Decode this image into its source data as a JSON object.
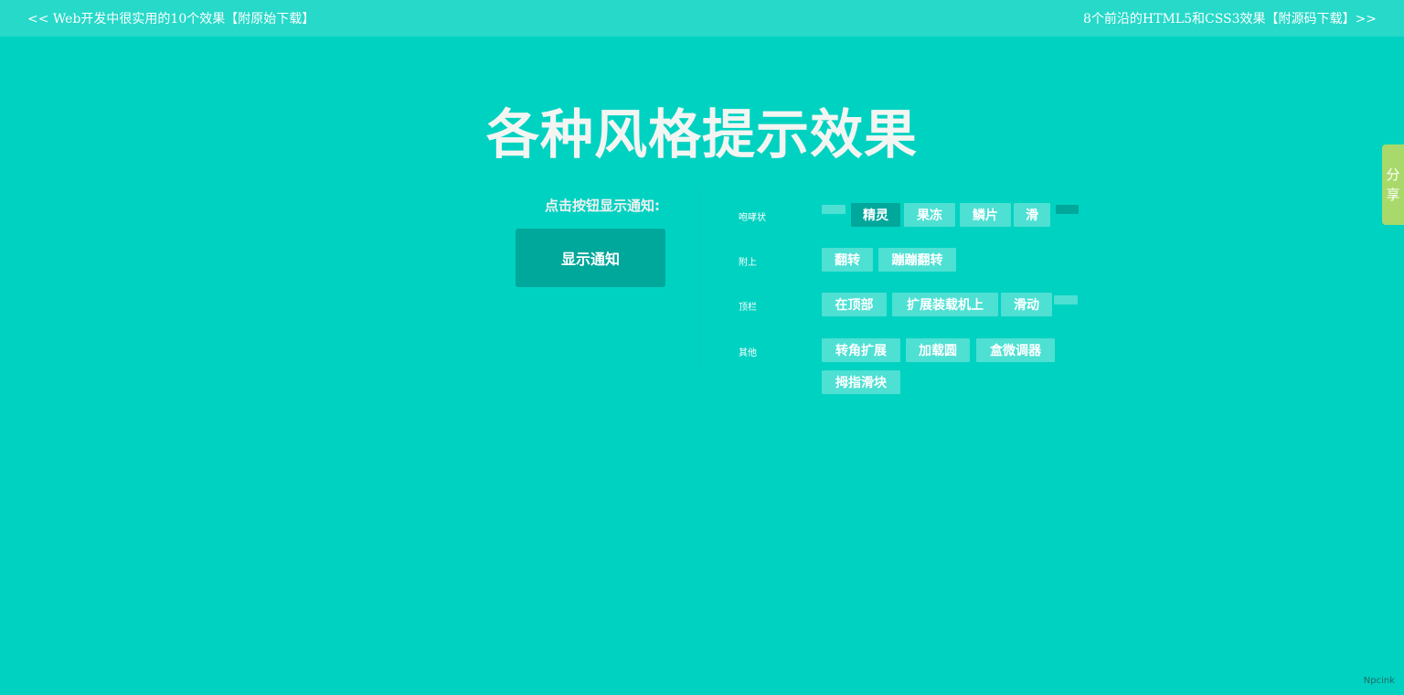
{
  "nav": {
    "prev": "<< Web开发中很实用的10个效果【附原始下载】",
    "next": "8个前沿的HTML5和CSS3效果【附源码下载】>>"
  },
  "page_title": "各种风格提示效果",
  "left": {
    "prompt": "点击按钮显示通知:",
    "show_button": "显示通知"
  },
  "rows": [
    {
      "label": "咆哮状",
      "options": [
        "",
        "精灵",
        "果冻",
        "鳞片",
        "滑",
        ""
      ]
    },
    {
      "label": "附上",
      "options": [
        "翻转",
        "蹦蹦翻转"
      ]
    },
    {
      "label": "顶栏",
      "options": [
        "在顶部",
        "扩展装载机上",
        "滑动",
        ""
      ]
    },
    {
      "label": "其他",
      "options": [
        "转角扩展",
        "加载圆",
        "盒微调器",
        "拇指滑块"
      ]
    }
  ],
  "share": {
    "line1": "分",
    "line2": "享"
  },
  "brand": "Npcink",
  "colors": {
    "background": "#00d2c1",
    "topbar": "#26d9c9",
    "button_dark": "#00a79b",
    "option": "#4de0d3",
    "share": "#a8d96a"
  }
}
